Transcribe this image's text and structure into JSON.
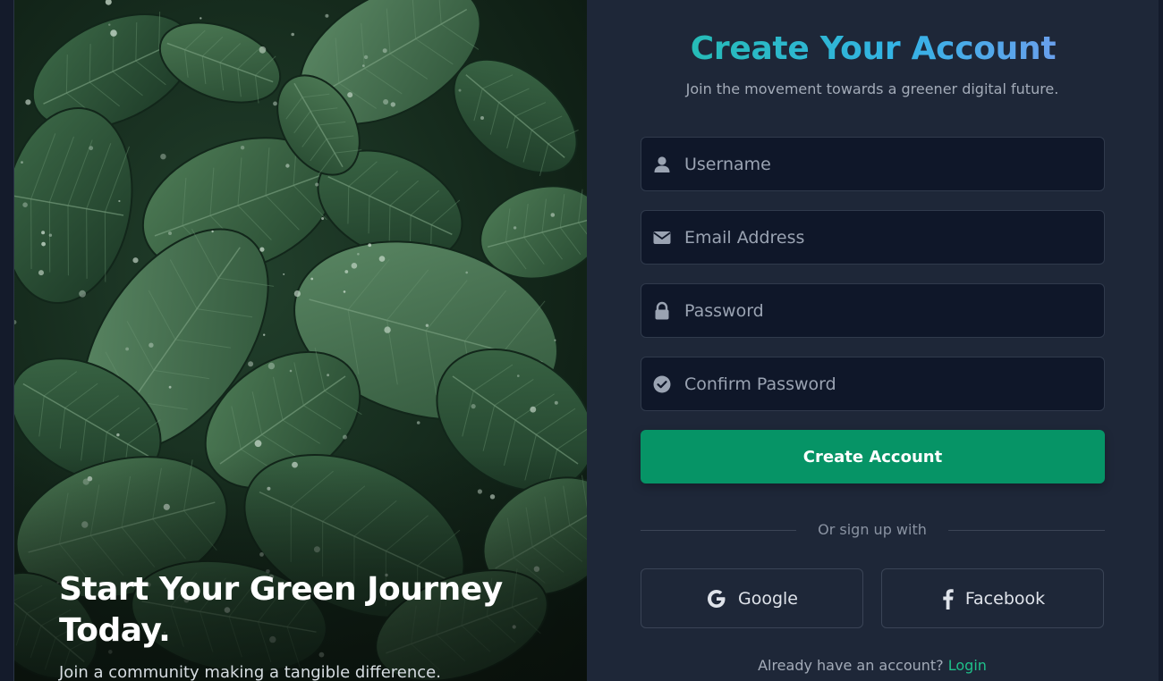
{
  "hero": {
    "title": "Start Your Green Journey Today.",
    "subtitle": "Join a community making a tangible difference."
  },
  "form": {
    "title": "Create Your Account",
    "subtitle": "Join the movement towards a greener digital future.",
    "fields": [
      {
        "placeholder": "Username",
        "icon": "user-icon"
      },
      {
        "placeholder": "Email Address",
        "icon": "envelope-icon"
      },
      {
        "placeholder": "Password",
        "icon": "lock-icon"
      },
      {
        "placeholder": "Confirm Password",
        "icon": "check-circle-icon"
      }
    ],
    "submit_label": "Create Account",
    "divider_text": "Or sign up with",
    "social": {
      "google_label": "Google",
      "facebook_label": "Facebook"
    },
    "footer": {
      "prompt": "Already have an account?",
      "login_label": "Login"
    }
  },
  "colors": {
    "accent_green": "#069466",
    "link_green": "#1fc08a",
    "panel_bg": "#1e2738",
    "input_bg": "#0f1729",
    "title_gradient": [
      "#1fc0a0",
      "#34b3e6",
      "#8c92f0"
    ]
  }
}
